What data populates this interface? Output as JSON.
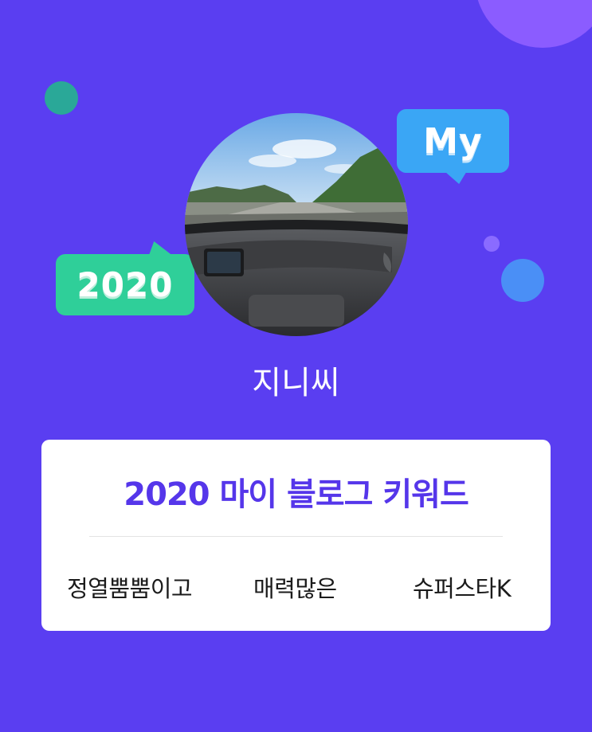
{
  "profile": {
    "name": "지니씨",
    "avatar_alt": "avatar photo"
  },
  "bubbles": {
    "year": "2020",
    "my": "My"
  },
  "card": {
    "title": "2020 마이 블로그 키워드",
    "keywords": [
      "정열뿜뿜이고",
      "매력많은",
      "슈퍼스타K"
    ]
  },
  "colors": {
    "background": "#5a3ef1",
    "accent_title": "#5536ea",
    "bubble_2020": "#2fcf99",
    "bubble_my": "#3aa6f5"
  }
}
